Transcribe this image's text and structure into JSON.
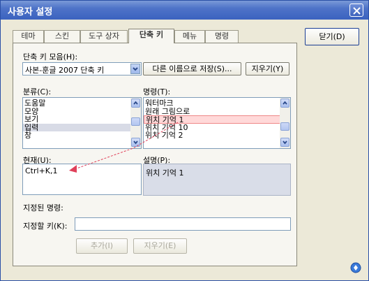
{
  "window": {
    "title": "사용자 설정"
  },
  "tabs": [
    "테마",
    "스킨",
    "도구 상자",
    "단축 키",
    "메뉴",
    "명령"
  ],
  "active_tab": "단축 키",
  "close_button": "닫기(D)",
  "shortcut_set": {
    "label": "단축 키 모음(H):",
    "value": "사본-훈글 2007 단축 키",
    "save_as": "다른 이름으로 저장(S)...",
    "delete": "지우기(Y)"
  },
  "category": {
    "label": "분류(C):",
    "items": [
      "도움말",
      "모양",
      "보기",
      "입력",
      "창"
    ],
    "selected": "입력"
  },
  "command": {
    "label": "명령(T):",
    "items": [
      "워터마크",
      "원래 그림으로",
      "위치 기억 1",
      "위치 기억 10",
      "위치 기억 2"
    ],
    "selected": "위치 기억 1"
  },
  "current": {
    "label": "현재(U):",
    "value": "Ctrl+K,1"
  },
  "description": {
    "label": "설명(P):",
    "value": "위치 기억 1"
  },
  "assigned_label": "지정된 명령:",
  "assign_key": {
    "label": "지정할 키(K):",
    "value": ""
  },
  "buttons": {
    "add": "추가(I)",
    "remove": "지우기(E)"
  },
  "colors": {
    "accent": "#3b63bf",
    "annotation": "#e0405a"
  }
}
